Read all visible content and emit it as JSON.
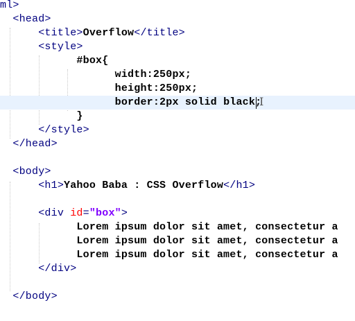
{
  "code": {
    "html_close_fragment": "ml>",
    "head_open": "<head>",
    "title_open": "<title>",
    "title_text": "Overflow",
    "title_close": "</title>",
    "style_open": "<style>",
    "selector": "#box{",
    "decl_width": "width:250px;",
    "decl_height": "height:250px;",
    "decl_border": "border:2px solid black;",
    "rule_close": "}",
    "style_close": "</style>",
    "head_close": "</head>",
    "body_open": "<body>",
    "h1_open": "<h1>",
    "h1_text": "Yahoo Baba : CSS Overflow",
    "h1_close": "</h1>",
    "div_open_start": "<div ",
    "div_attr_name": "id",
    "div_attr_eq": "=",
    "div_attr_value": "\"box\"",
    "div_open_end": ">",
    "lorem_line_1": "Lorem ipsum dolor sit amet, consectetur a",
    "lorem_line_2": "Lorem ipsum dolor sit amet, consectetur a",
    "lorem_line_3": "Lorem ipsum dolor sit amet, consectetur a",
    "div_close": "</div>",
    "body_close": "</body>"
  },
  "cursor_icon": "i-beam-icon",
  "colors": {
    "tag": "#000080",
    "attribute_name": "#ff0000",
    "attribute_value": "#8000ff",
    "current_line_highlight": "#e8f2fe"
  }
}
